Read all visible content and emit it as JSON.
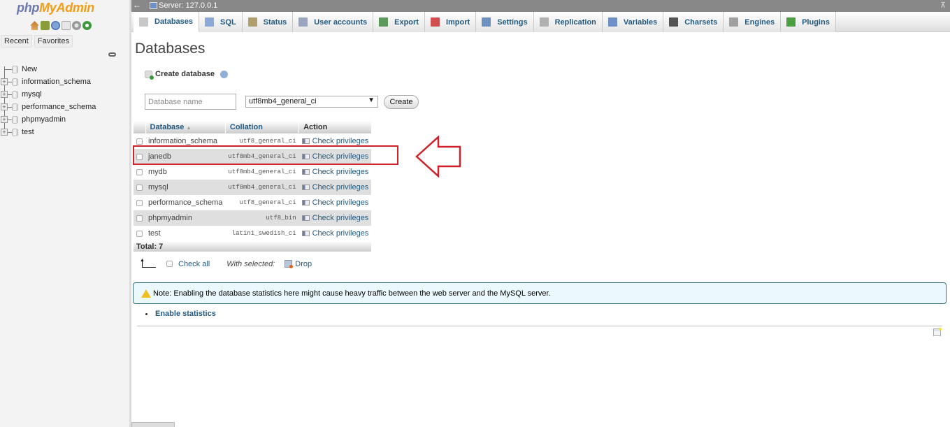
{
  "sidebar": {
    "logo_php": "php",
    "logo_myadmin": "MyAdmin",
    "nav_icons": [
      "home-icon",
      "logout-icon",
      "help-icon",
      "docs-icon",
      "settings-icon",
      "reload-icon"
    ],
    "tabs": [
      "Recent",
      "Favorites"
    ],
    "tree": [
      {
        "label": "New",
        "icon": "new-db-icon"
      },
      {
        "label": "information_schema",
        "icon": "database-icon"
      },
      {
        "label": "mysql",
        "icon": "database-icon"
      },
      {
        "label": "performance_schema",
        "icon": "database-icon"
      },
      {
        "label": "phpmyadmin",
        "icon": "database-icon"
      },
      {
        "label": "test",
        "icon": "database-icon"
      }
    ]
  },
  "server_bar": {
    "back_glyph": "←",
    "label": "Server: 127.0.0.1",
    "collapse_glyph": "⊼"
  },
  "tabs": [
    {
      "label": "Databases",
      "icon": "database-icon",
      "color": "#c8c8c8",
      "active": true
    },
    {
      "label": "SQL",
      "icon": "sql-icon",
      "color": "#8aa8d8"
    },
    {
      "label": "Status",
      "icon": "status-icon",
      "color": "#b0a070"
    },
    {
      "label": "User accounts",
      "icon": "user-accounts-icon",
      "color": "#9aa6c0"
    },
    {
      "label": "Export",
      "icon": "export-icon",
      "color": "#5c9a5c"
    },
    {
      "label": "Import",
      "icon": "import-icon",
      "color": "#d05050"
    },
    {
      "label": "Settings",
      "icon": "wrench-icon",
      "color": "#6c90c0"
    },
    {
      "label": "Replication",
      "icon": "replication-icon",
      "color": "#b0b0b0"
    },
    {
      "label": "Variables",
      "icon": "variables-icon",
      "color": "#7090c8"
    },
    {
      "label": "Charsets",
      "icon": "charsets-icon",
      "color": "#555555"
    },
    {
      "label": "Engines",
      "icon": "engines-icon",
      "color": "#a0a0a0"
    },
    {
      "label": "Plugins",
      "icon": "plugins-icon",
      "color": "#4aa040"
    }
  ],
  "main": {
    "title": "Databases",
    "create_db": {
      "heading": "Create database",
      "name_placeholder": "Database name",
      "name_value": "",
      "collation_selected": "utf8mb4_general_ci",
      "create_label": "Create"
    },
    "table": {
      "headers": {
        "database": "Database",
        "sort_glyph": "▲",
        "collation": "Collation",
        "action": "Action"
      },
      "rows": [
        {
          "name": "information_schema",
          "collation": "utf8_general_ci",
          "action": "Check privileges"
        },
        {
          "name": "janedb",
          "collation": "utf8mb4_general_ci",
          "action": "Check privileges"
        },
        {
          "name": "mydb",
          "collation": "utf8mb4_general_ci",
          "action": "Check privileges"
        },
        {
          "name": "mysql",
          "collation": "utf8mb4_general_ci",
          "action": "Check privileges"
        },
        {
          "name": "performance_schema",
          "collation": "utf8_general_ci",
          "action": "Check privileges"
        },
        {
          "name": "phpmyadmin",
          "collation": "utf8_bin",
          "action": "Check privileges"
        },
        {
          "name": "test",
          "collation": "latin1_swedish_ci",
          "action": "Check privileges"
        }
      ],
      "total": "Total: 7"
    },
    "bulk": {
      "check_all": "Check all",
      "with_selected": "With selected:",
      "drop": "Drop"
    },
    "notice": "Note: Enabling the database statistics here might cause heavy traffic between the web server and the MySQL server.",
    "enable_statistics": "Enable statistics",
    "annotation_color": "#d0202a"
  }
}
